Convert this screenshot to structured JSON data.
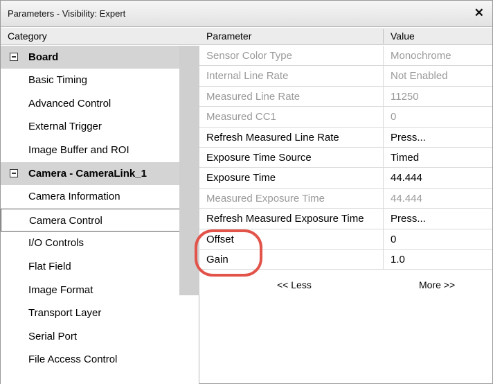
{
  "window": {
    "title": "Parameters - Visibility: Expert",
    "close_label": "✕"
  },
  "category_header": "Category",
  "categories": [
    {
      "label": "Board",
      "group": true
    },
    {
      "label": "Basic Timing"
    },
    {
      "label": "Advanced Control"
    },
    {
      "label": "External Trigger"
    },
    {
      "label": "Image Buffer and ROI"
    },
    {
      "label": "Camera - CameraLink_1",
      "group": true
    },
    {
      "label": "Camera Information"
    },
    {
      "label": "Camera Control",
      "selected": true
    },
    {
      "label": "I/O Controls"
    },
    {
      "label": "Flat Field"
    },
    {
      "label": "Image Format"
    },
    {
      "label": "Transport Layer"
    },
    {
      "label": "Serial Port"
    },
    {
      "label": "File Access Control"
    }
  ],
  "grid": {
    "header_parameter": "Parameter",
    "header_value": "Value",
    "rows": [
      {
        "parameter": "Sensor Color Type",
        "value": "Monochrome",
        "disabled": true
      },
      {
        "parameter": "Internal Line Rate",
        "value": "Not Enabled",
        "disabled": true
      },
      {
        "parameter": "Measured Line Rate",
        "value": "11250",
        "disabled": true
      },
      {
        "parameter": "Measured CC1",
        "value": "0",
        "disabled": true
      },
      {
        "parameter": "Refresh Measured Line Rate",
        "value": "Press...",
        "disabled": false
      },
      {
        "parameter": "Exposure Time Source",
        "value": "Timed",
        "disabled": false
      },
      {
        "parameter": "Exposure Time",
        "value": "44.444",
        "disabled": false
      },
      {
        "parameter": "Measured Exposure Time",
        "value": "44.444",
        "disabled": true
      },
      {
        "parameter": "Refresh Measured Exposure Time",
        "value": "Press...",
        "disabled": false
      },
      {
        "parameter": "Offset",
        "value": "0",
        "disabled": false
      },
      {
        "parameter": "Gain",
        "value": "1.0",
        "disabled": false
      }
    ],
    "less_label": "<< Less",
    "more_label": "More >>"
  },
  "colors": {
    "highlight": "#e2534a",
    "group_bg": "#d4d4d4",
    "disabled_text": "#9a9a9a"
  }
}
